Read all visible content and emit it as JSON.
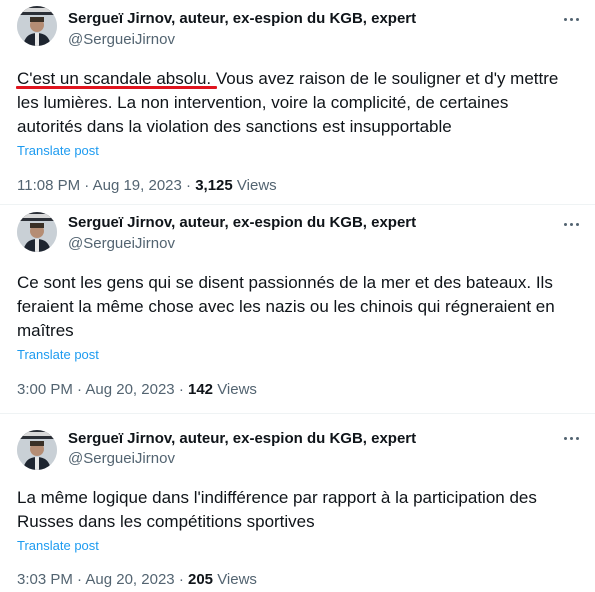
{
  "posts": [
    {
      "display_name": "Sergueï Jirnov, auteur, ex-espion du KGB, expert",
      "handle": "@SergueiJirnov",
      "lines": [
        "C'est un scandale absolu. Vous avez raison de le souligner et d'y mettre",
        "les lumières. La non intervention, voire la complicité, de certaines",
        "autorités dans la violation des sanctions est insupportable"
      ],
      "highlight": "C'est un scandale absolu.",
      "highlight_color": "#e0141e",
      "translate": "Translate post",
      "time": "11:08 PM",
      "date": "Aug 19, 2023",
      "views_count": "3,125",
      "views_label": "Views"
    },
    {
      "display_name": "Sergueï Jirnov, auteur, ex-espion du KGB, expert",
      "handle": "@SergueiJirnov",
      "lines": [
        "Ce sont les gens qui se disent passionnés de la mer et des bateaux. Ils",
        "feraient la même chose avec les nazis ou les chinois qui régneraient en",
        "maîtres"
      ],
      "translate": "Translate post",
      "time": "3:00 PM",
      "date": "Aug 20, 2023",
      "views_count": "142",
      "views_label": "Views"
    },
    {
      "display_name": "Sergueï Jirnov, auteur, ex-espion du KGB, expert",
      "handle": "@SergueiJirnov",
      "lines": [
        "La même logique dans l'indifférence par rapport à la participation des",
        "Russes dans les compétitions sportives"
      ],
      "translate": "Translate post",
      "time": "3:03 PM",
      "date": "Aug 20, 2023",
      "views_count": "205",
      "views_label": "Views"
    }
  ],
  "meta_separator": "·",
  "link_color": "#1d9bf0",
  "text_color": "#0f1419",
  "muted_color": "#536471"
}
